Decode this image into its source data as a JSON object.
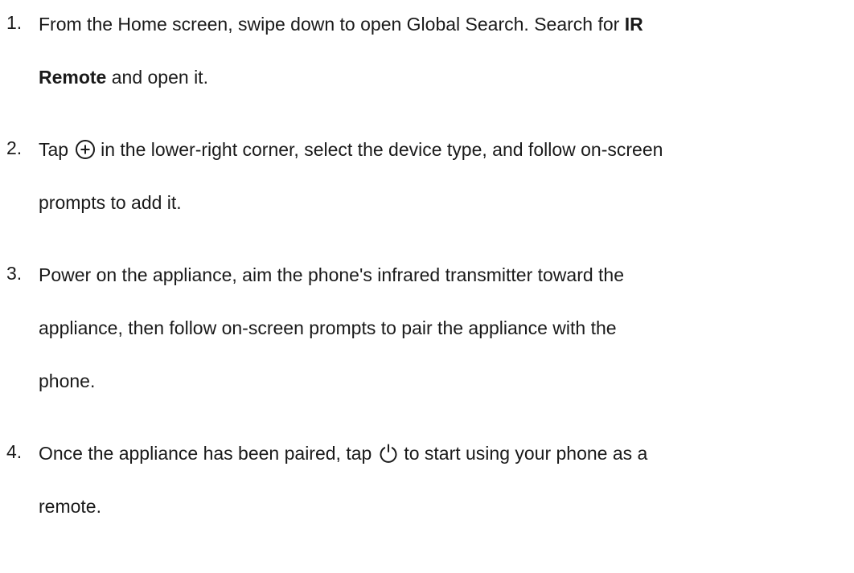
{
  "steps": [
    {
      "number": "1.",
      "lines": [
        {
          "parts": [
            "From the Home screen, swipe down to open Global Search. Search for ",
            "IR"
          ]
        },
        {
          "parts": [
            "Remote",
            " and open it."
          ]
        }
      ]
    },
    {
      "number": "2.",
      "lines": [
        {
          "before": "Tap",
          "icon": "add-circle-icon",
          "after": "in the lower-right corner, select the device type, and follow on-screen"
        },
        {
          "text": "prompts to add it."
        }
      ]
    },
    {
      "number": "3.",
      "lines": [
        {
          "text": "Power on the appliance, aim the phone's infrared transmitter toward the"
        },
        {
          "text": "appliance, then follow on-screen prompts to pair the appliance with the"
        },
        {
          "text": "phone."
        }
      ]
    },
    {
      "number": "4.",
      "lines": [
        {
          "before": "Once the appliance has been paired, tap",
          "icon": "power-icon",
          "after": "to start using your phone as a"
        },
        {
          "text": "remote."
        }
      ]
    }
  ]
}
